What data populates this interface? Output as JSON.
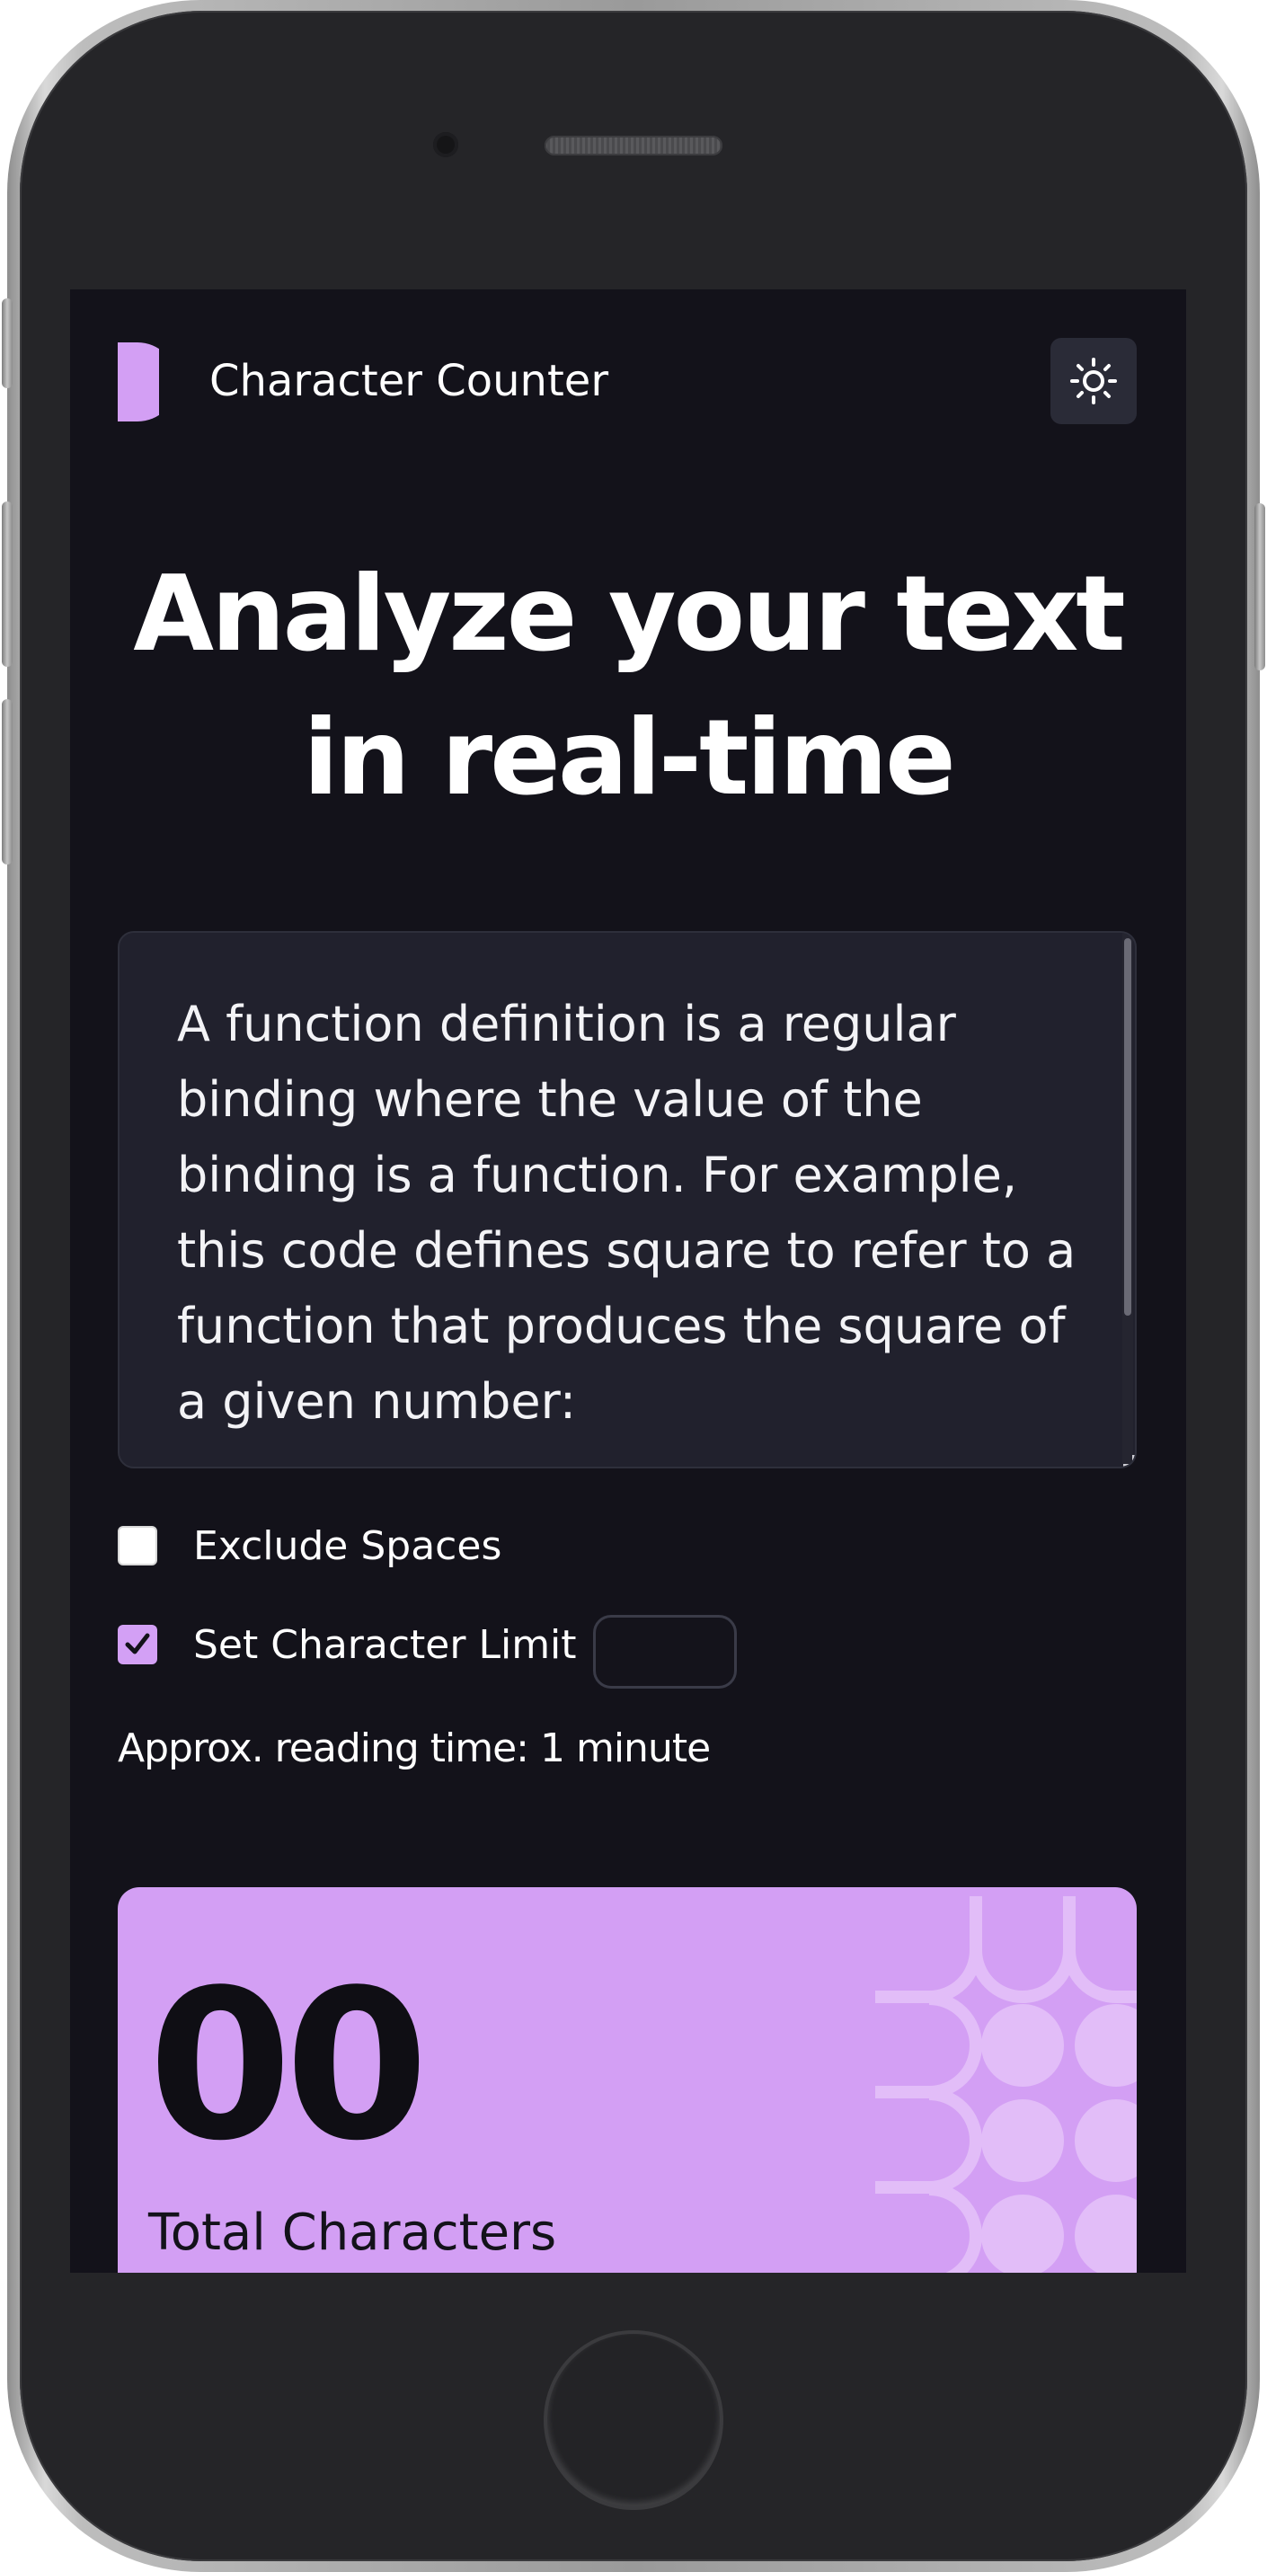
{
  "header": {
    "app_title": "Character Counter",
    "logo_icon": "half-circle-logo-icon",
    "theme_toggle_icon": "sun-icon"
  },
  "hero": {
    "headline": "Analyze your text in real-time"
  },
  "text_input": {
    "value": "A function definition is a regular binding where the value of the binding is a function. For example, this code defines square to refer to a function that produces the square of a given number:"
  },
  "options": {
    "exclude_spaces": {
      "label": "Exclude Spaces",
      "checked": false
    },
    "character_limit": {
      "label": "Set Character Limit",
      "checked": true,
      "value": ""
    }
  },
  "reading_time": "Approx. reading time: 1 minute",
  "stats": {
    "total_characters": {
      "value": "00",
      "label": "Total Characters"
    }
  },
  "colors": {
    "background": "#13121a",
    "surface": "#21212d",
    "accent": "#d39ff4",
    "text": "#ffffff"
  }
}
